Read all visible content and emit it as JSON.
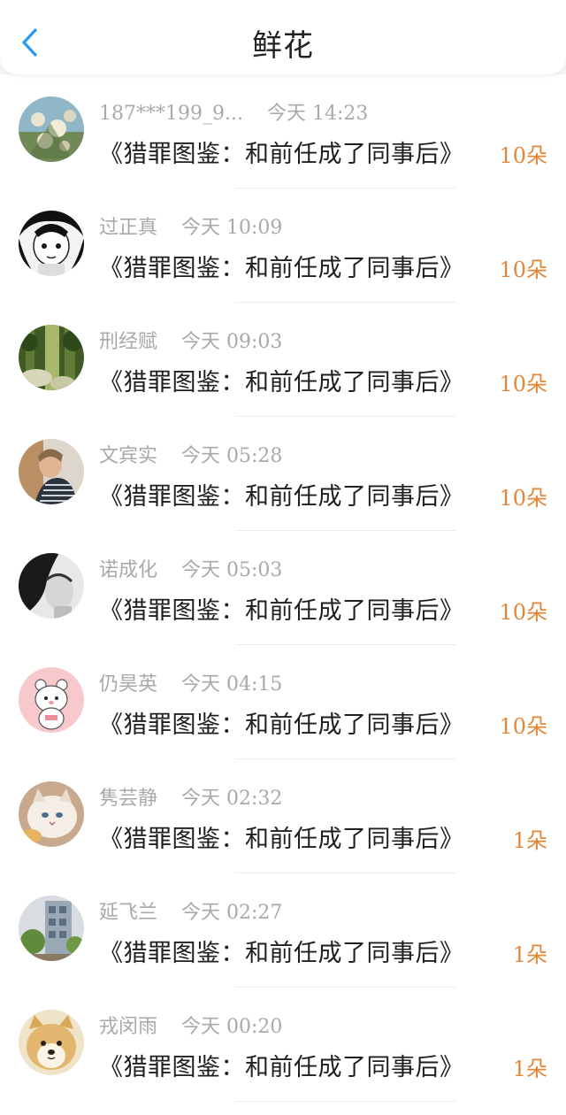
{
  "header": {
    "title": "鲜花",
    "back_icon": "chevron-left-icon",
    "accent": "#2d9be9"
  },
  "colors": {
    "count": "#e2873a",
    "meta": "#a9a9a9",
    "text": "#1f1f1f"
  },
  "items": [
    {
      "name": "187***199_9...",
      "time": "今天 14:23",
      "book": "《猎罪图鉴：和前任成了同事后》",
      "count": "10朵",
      "avatar": "flowers-photo-avatar"
    },
    {
      "name": "过正真",
      "time": "今天 10:09",
      "book": "《猎罪图鉴：和前任成了同事后》",
      "count": "10朵",
      "avatar": "anime-girl-avatar"
    },
    {
      "name": "刑经赋",
      "time": "今天 09:03",
      "book": "《猎罪图鉴：和前任成了同事后》",
      "count": "10朵",
      "avatar": "forest-photo-avatar"
    },
    {
      "name": "文宾实",
      "time": "今天 05:28",
      "book": "《猎罪图鉴：和前任成了同事后》",
      "count": "10朵",
      "avatar": "man-photo-avatar"
    },
    {
      "name": "诺成化",
      "time": "今天 05:03",
      "book": "《猎罪图鉴：和前任成了同事后》",
      "count": "10朵",
      "avatar": "bw-portrait-avatar"
    },
    {
      "name": "仍昊英",
      "time": "今天 04:15",
      "book": "《猎罪图鉴：和前任成了同事后》",
      "count": "10朵",
      "avatar": "cartoon-bear-avatar"
    },
    {
      "name": "隽芸静",
      "time": "今天 02:32",
      "book": "《猎罪图鉴：和前任成了同事后》",
      "count": "1朵",
      "avatar": "cat-photo-avatar"
    },
    {
      "name": "延飞兰",
      "time": "今天 02:27",
      "book": "《猎罪图鉴：和前任成了同事后》",
      "count": "1朵",
      "avatar": "building-photo-avatar"
    },
    {
      "name": "戎闵雨",
      "time": "今天 00:20",
      "book": "《猎罪图鉴：和前任成了同事后》",
      "count": "1朵",
      "avatar": "dog-photo-avatar"
    }
  ]
}
